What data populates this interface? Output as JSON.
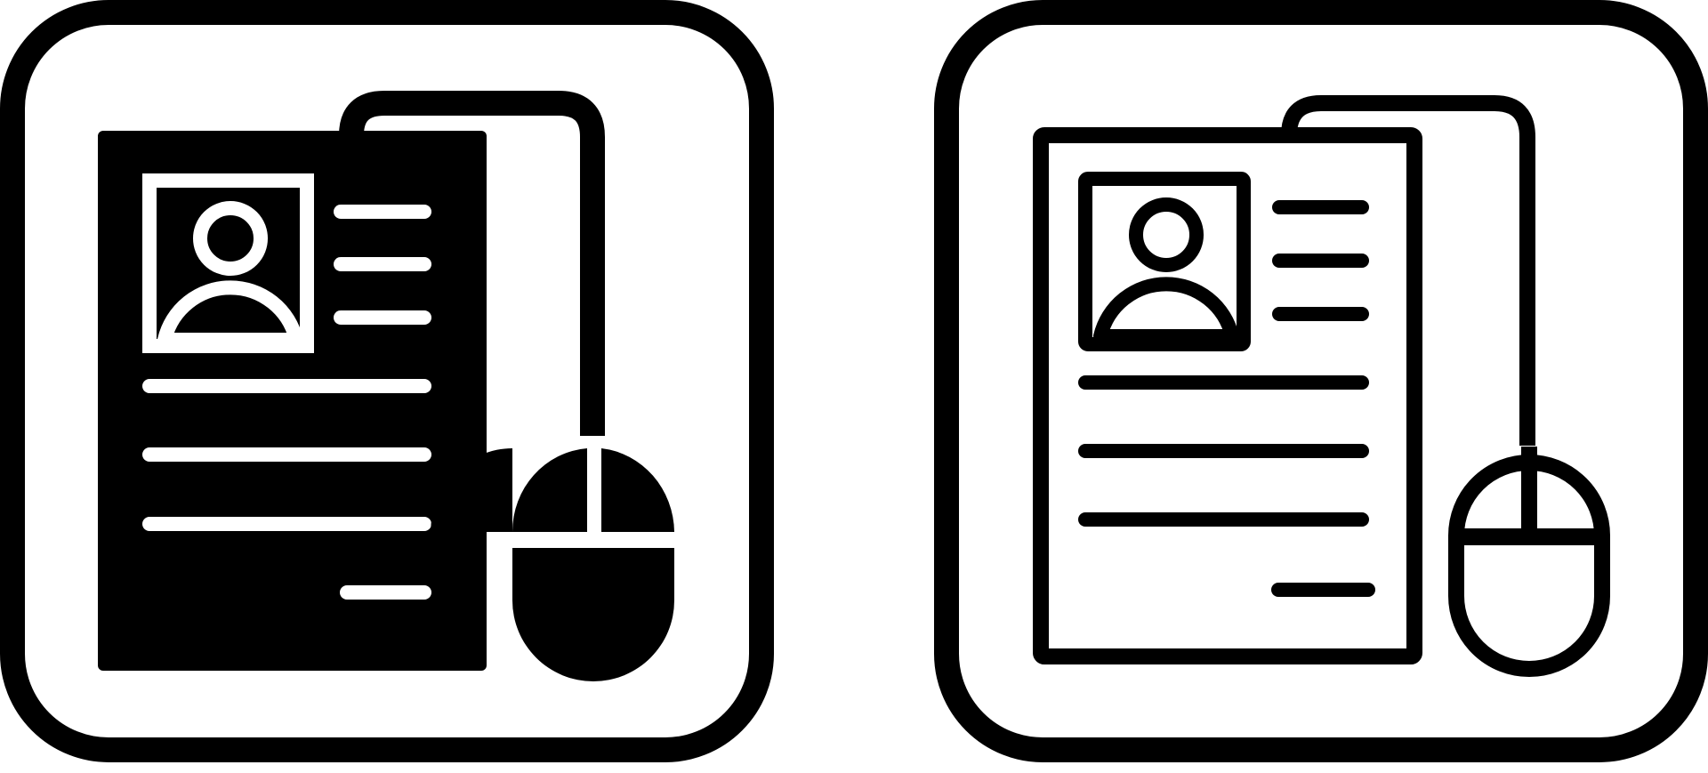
{
  "icons": [
    {
      "name": "online-resume-glyph-icon",
      "style": "solid"
    },
    {
      "name": "online-resume-outline-icon",
      "style": "outline"
    }
  ],
  "colors": {
    "stroke": "#000000",
    "background": "#ffffff"
  }
}
